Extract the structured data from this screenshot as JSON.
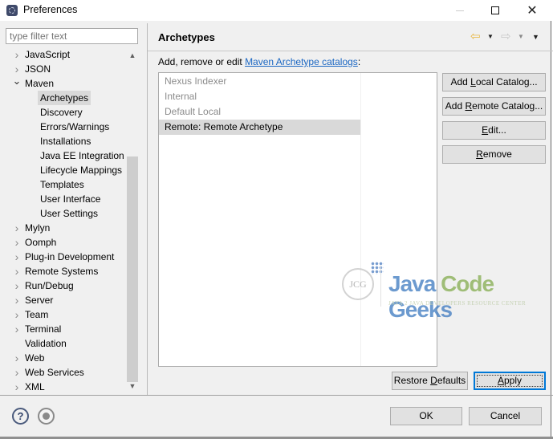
{
  "window": {
    "title": "Preferences",
    "minimize_icon": "minimize-icon",
    "maximize_icon": "maximize-icon",
    "close_icon": "close-icon"
  },
  "filter": {
    "placeholder": "type filter text",
    "value": ""
  },
  "tree": {
    "items": [
      {
        "label": "JavaScript",
        "level": 0,
        "expander": "collapsed"
      },
      {
        "label": "JSON",
        "level": 0,
        "expander": "collapsed"
      },
      {
        "label": "Maven",
        "level": 0,
        "expander": "expanded"
      },
      {
        "label": "Archetypes",
        "level": 1,
        "expander": "none",
        "selected": true
      },
      {
        "label": "Discovery",
        "level": 1,
        "expander": "none"
      },
      {
        "label": "Errors/Warnings",
        "level": 1,
        "expander": "none"
      },
      {
        "label": "Installations",
        "level": 1,
        "expander": "none"
      },
      {
        "label": "Java EE Integration",
        "level": 1,
        "expander": "none"
      },
      {
        "label": "Lifecycle Mappings",
        "level": 1,
        "expander": "none"
      },
      {
        "label": "Templates",
        "level": 1,
        "expander": "none"
      },
      {
        "label": "User Interface",
        "level": 1,
        "expander": "none"
      },
      {
        "label": "User Settings",
        "level": 1,
        "expander": "none"
      },
      {
        "label": "Mylyn",
        "level": 0,
        "expander": "collapsed"
      },
      {
        "label": "Oomph",
        "level": 0,
        "expander": "collapsed"
      },
      {
        "label": "Plug-in Development",
        "level": 0,
        "expander": "collapsed"
      },
      {
        "label": "Remote Systems",
        "level": 0,
        "expander": "collapsed"
      },
      {
        "label": "Run/Debug",
        "level": 0,
        "expander": "collapsed"
      },
      {
        "label": "Server",
        "level": 0,
        "expander": "collapsed"
      },
      {
        "label": "Team",
        "level": 0,
        "expander": "collapsed"
      },
      {
        "label": "Terminal",
        "level": 0,
        "expander": "collapsed"
      },
      {
        "label": "Validation",
        "level": 0,
        "expander": "none"
      },
      {
        "label": "Web",
        "level": 0,
        "expander": "collapsed"
      },
      {
        "label": "Web Services",
        "level": 0,
        "expander": "collapsed"
      },
      {
        "label": "XML",
        "level": 0,
        "expander": "collapsed"
      }
    ],
    "scroll_up_icon": "chevron-up-icon",
    "scroll_down_icon": "chevron-down-icon"
  },
  "page": {
    "title": "Archetypes",
    "description_prefix": "Add, remove or edit ",
    "description_link": "Maven Archetype catalogs",
    "description_suffix": ":",
    "nav": {
      "back_icon": "back-arrow-icon",
      "forward_icon": "forward-arrow-icon",
      "menu_icon": "view-menu-icon"
    },
    "catalogs": [
      {
        "label": "Nexus Indexer",
        "enabled": false
      },
      {
        "label": "Internal",
        "enabled": false
      },
      {
        "label": "Default Local",
        "enabled": false
      },
      {
        "label": "Remote: Remote Archetype",
        "enabled": true,
        "selected": true
      }
    ],
    "buttons": {
      "add_local_pre": "Add ",
      "add_local_mn": "L",
      "add_local_post": "ocal Catalog...",
      "add_remote_pre": "Add ",
      "add_remote_mn": "R",
      "add_remote_post": "emote Catalog...",
      "edit_mn": "E",
      "edit_post": "dit...",
      "remove_mn": "R",
      "remove_post": "emove",
      "restore_pre": "Restore ",
      "restore_mn": "D",
      "restore_post": "efaults",
      "apply_mn": "A",
      "apply_post": "pply"
    }
  },
  "footer": {
    "help_icon": "help-icon",
    "record_icon": "record-icon",
    "ok_label": "OK",
    "cancel_label": "Cancel"
  },
  "watermark": {
    "badge": "JCG",
    "word1": "Java",
    "word2": "Code",
    "word3": "Geeks",
    "tagline": "JAVA 2 JAVA DEVELOPERS RESOURCE CENTER"
  }
}
